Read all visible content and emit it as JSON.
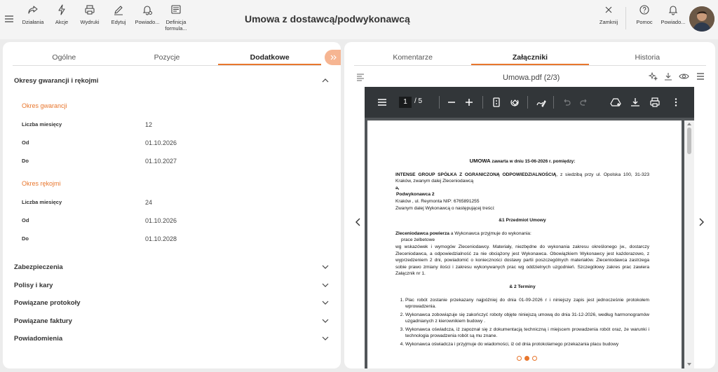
{
  "topbar": {
    "actions": [
      {
        "label": "Działania",
        "icon": "share-icon"
      },
      {
        "label": "Akcje",
        "icon": "lightning-icon"
      },
      {
        "label": "Wydruki",
        "icon": "printer-icon"
      },
      {
        "label": "Edytuj",
        "icon": "edit-icon"
      },
      {
        "label": "Powiado...",
        "icon": "bell-settings-icon"
      },
      {
        "label": "Definicja formula...",
        "icon": "form-definition-icon"
      }
    ],
    "title": "Umowa z dostawcą/podwykonawcą",
    "right_actions": [
      {
        "label": "Zamknij",
        "icon": "close-icon"
      },
      {
        "label": "Pomoc",
        "icon": "help-icon"
      },
      {
        "label": "Powiado...",
        "icon": "bell-icon"
      }
    ]
  },
  "left": {
    "tabs": [
      "Ogólne",
      "Pozycje",
      "Dodatkowe"
    ],
    "active_tab": "Dodatkowe",
    "sections": {
      "warranty": "Okresy gwarancji i rękojmi",
      "guarantee_period": "Okres gwarancji",
      "guarantee_fields": [
        {
          "label": "Liczba miesięcy",
          "value": "12"
        },
        {
          "label": "Od",
          "value": "01.10.2026"
        },
        {
          "label": "Do",
          "value": "01.10.2027"
        }
      ],
      "warranty_period": "Okres rękojmi",
      "warranty_fields": [
        {
          "label": "Liczba miesięcy",
          "value": "24"
        },
        {
          "label": "Od",
          "value": "01.10.2026"
        },
        {
          "label": "Do",
          "value": "01.10.2028"
        }
      ],
      "collapsed": [
        "Zabezpieczenia",
        "Polisy i kary",
        "Powiązane protokoły",
        "Powiązane faktury",
        "Powiadomienia"
      ]
    }
  },
  "right": {
    "tabs": [
      "Komentarze",
      "Załączniki",
      "Historia"
    ],
    "active_tab": "Załączniki",
    "doc_title": "Umowa.pdf (2/3)",
    "pdf": {
      "page": "1",
      "total": "/ 5"
    },
    "document": {
      "title_bold": "UMOWA",
      "title_rest": " zawarta w dniu 15-06-2026 r. pomiędzy:",
      "party1_bold": "INTENSE GROUP SPÓŁKA Z OGRANICZONĄ ODPOWIEDZIALNOŚCIĄ",
      "party1_rest": ", z siedzibą przy ul. Opolska 100, 31-323 Kraków, zwanym dalej Zleceniodawcą",
      "and": "a,",
      "party2_name": "Podwykonawca 2",
      "party2_addr": "Kraków , ul. Reymonta NIP: 6765891255",
      "party2_called": "Zwanym dalej Wykonawcą o następującej treści:",
      "sec1": "&1 Przedmiot Umowy",
      "sec1_intro_bold": "Zleceniodawca powierza",
      "sec1_intro_rest": " a Wykonawca przyjmuje do wykonania:",
      "sec1_item": "prace żelbetowe",
      "sec1_body": "wg wskazówek i wymogów Zleceniodawcy. Materiały, niezbędne do wykonania zakresu określonego jw., dostarczy Zleceniodawca, a odpowiedzialność za nie obciążony jest Wykonawca. Obowiązkiem Wykonawcy jest każdorazowo, z wyprzedzeniem 2 dni, powiadomić o konieczności dostawy partii poszczególnych materiałów. Zleceniodawca zastrzega sobie prawo zmiany ilości i zakresu wykonywanych prac wg oddzielnych uzgodnień. Szczegółowy zakres prac zawiera Załącznik nr 1.",
      "sec2": "& 2 Terminy",
      "sec2_items": [
        "Plac robót zostanie przekazany najpóźniej do dnia 01-09-2026 r i niniejszy zapis jest jednocześnie protokołem wprowadzenia.",
        "Wykonawca zobowiązuje się zakończyć roboty objęte niniejszą umową do dnia 31-12-2026, według harmonogramów uzgadnianych z kierownikiem budowy .",
        "Wykonawca oświadcza, iż zapoznał się z dokumentacją techniczną i miejscem prowadzenia robót oraz, że warunki i technologia prowadzenia robót są mu znane.",
        "Wykonawca oświadcza i przyjmuje do wiadomości, iż od dnia protokolarnego przekazania placu budowy"
      ]
    },
    "carousel_total": 3,
    "carousel_active": 1
  },
  "colors": {
    "accent": "#e8762d",
    "pdf_toolbar": "#323639",
    "pdf_bg": "#525659"
  }
}
